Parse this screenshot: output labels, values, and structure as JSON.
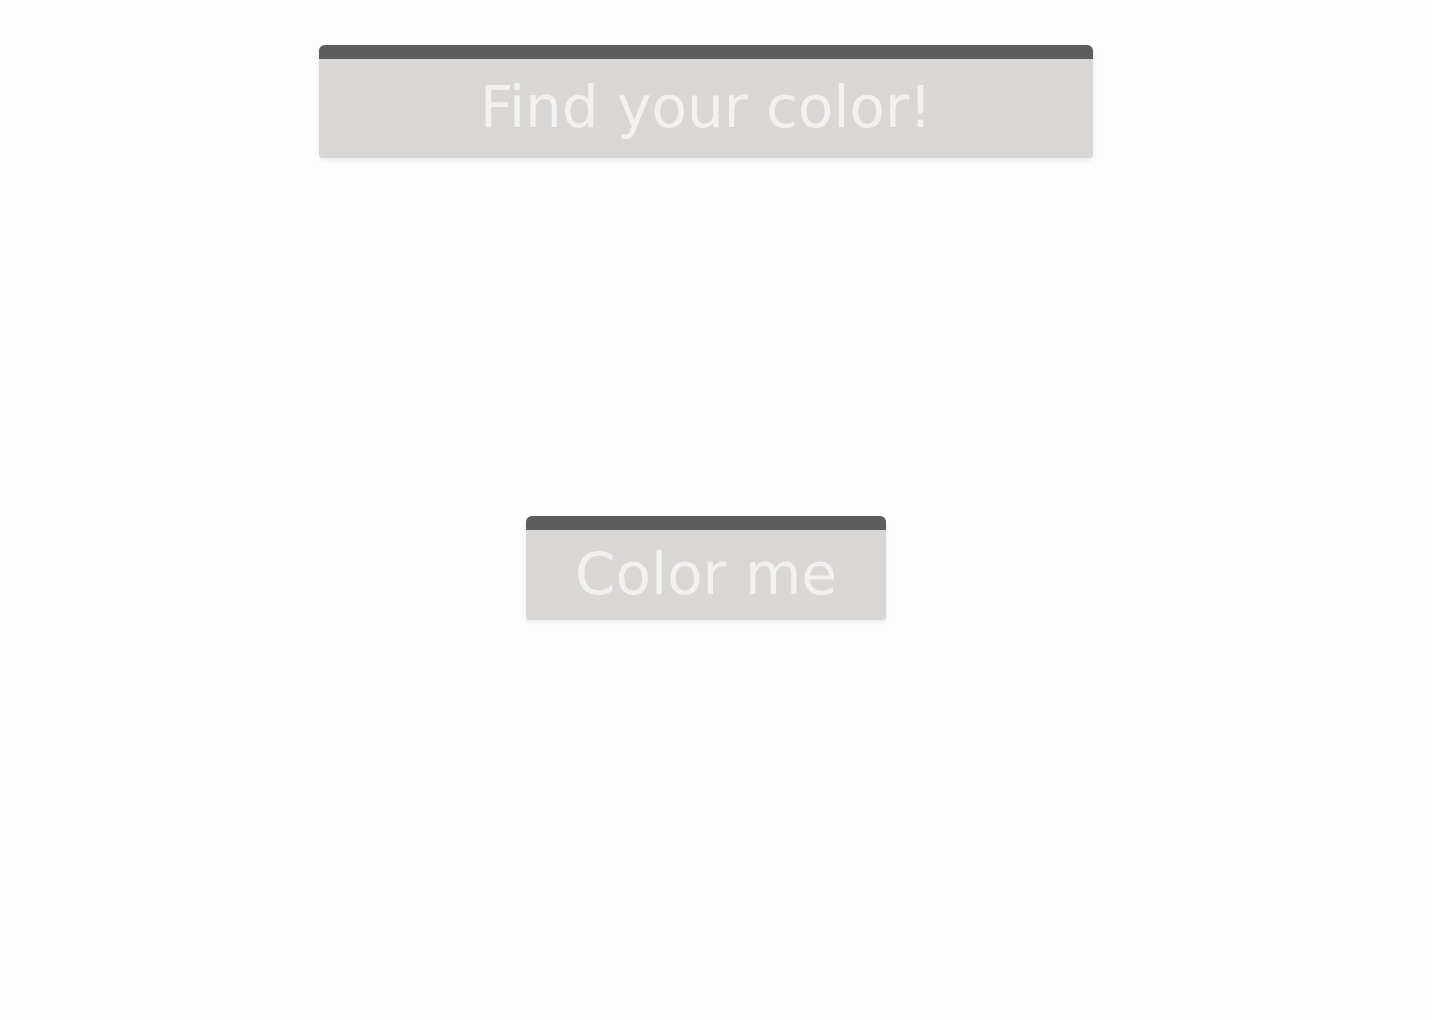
{
  "header": {
    "title": "Find your color!"
  },
  "action": {
    "button_label": "Color me"
  },
  "colors": {
    "background": "#fdfdfd",
    "card": "#d8d7d6",
    "bar": "#5d5d5d",
    "text": "#f2f1f0"
  }
}
